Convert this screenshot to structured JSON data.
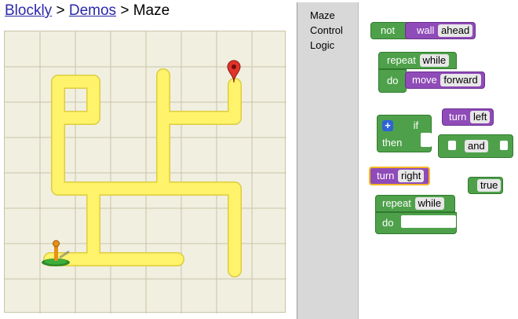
{
  "breadcrumb": {
    "link1": "Blockly",
    "sep1": ">",
    "link2": "Demos",
    "sep2": ">",
    "current": "Maze"
  },
  "toolbox": {
    "categories": [
      "Maze",
      "Control",
      "Logic"
    ]
  },
  "blocks": {
    "not_wall": {
      "keyword": "not",
      "purple_label": "wall",
      "option": "ahead"
    },
    "repeat_move": {
      "repeat": "repeat",
      "while": "while",
      "do": "do",
      "move": "move",
      "option": "forward"
    },
    "if_then": {
      "if": "if",
      "then": "then"
    },
    "turn_left": {
      "turn": "turn",
      "option": "left"
    },
    "and": {
      "option": "and"
    },
    "turn_right": {
      "turn": "turn",
      "option": "right"
    },
    "true": {
      "option": "true"
    },
    "repeat2": {
      "repeat": "repeat",
      "while": "while",
      "do": "do"
    }
  },
  "colors": {
    "control_green": "#4ea14a",
    "maze_purple": "#8f4bb8",
    "path_yellow": "#fff36b",
    "link_blue": "#2a2aa8"
  },
  "icons": {
    "goal": "red-map-pin",
    "avatar": "pegman-on-green-pad"
  }
}
